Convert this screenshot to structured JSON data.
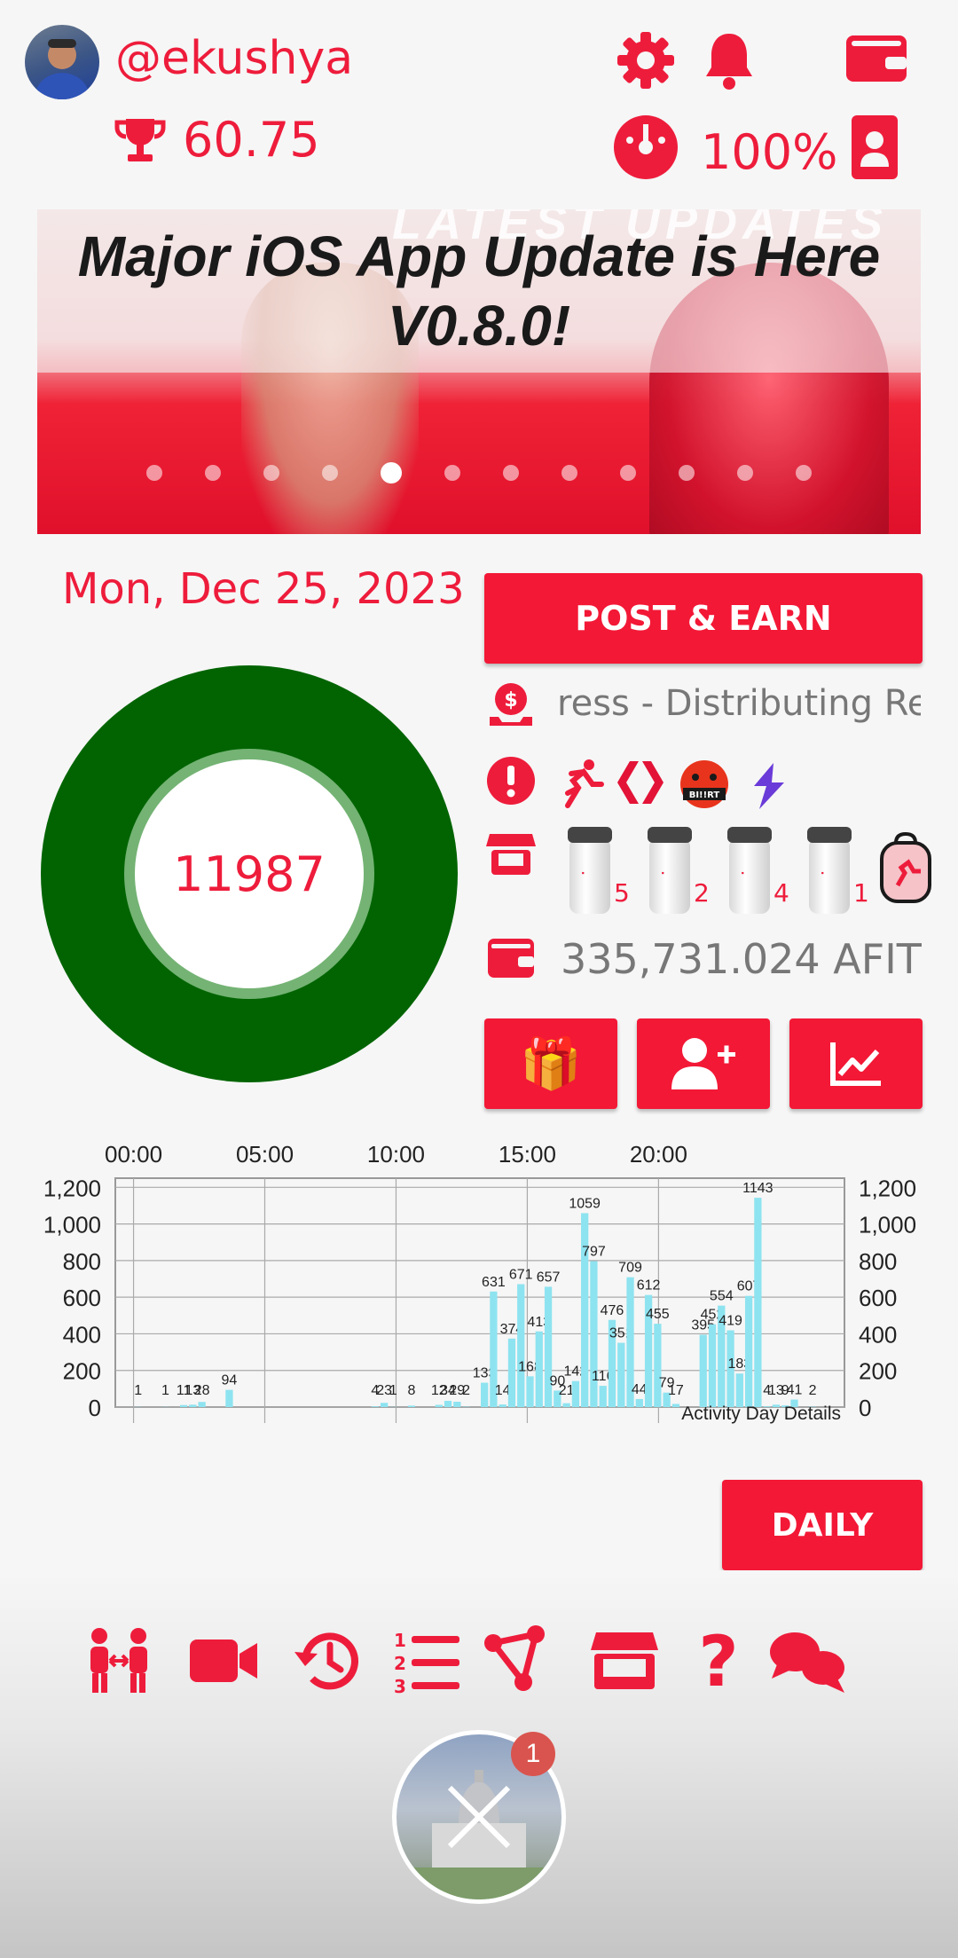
{
  "header": {
    "username": "@ekushya",
    "score": "60.75",
    "battery_pct": "100%"
  },
  "banner": {
    "watermark": "LATEST UPDATES",
    "title_line1": "Major iOS App Update is Here",
    "title_line2": "V0.8.0!",
    "dot_count": 12,
    "active_dot": 4
  },
  "activity": {
    "date": "Mon, Dec 25, 2023",
    "steps": "11987"
  },
  "actions": {
    "post_earn_label": "POST & EARN",
    "ticker_text": "ress - Distributing Rewa",
    "afit_balance": "335,731.024 AFIT",
    "daily_label": "DAILY",
    "gift_emoji": "🎁",
    "bertt_label": "BI!!RT"
  },
  "products": [
    {
      "count": "5"
    },
    {
      "count": "2"
    },
    {
      "count": "4"
    },
    {
      "count": "1"
    }
  ],
  "fab": {
    "badge": "1"
  },
  "colors": {
    "brand_red": "#f31836",
    "ring_green": "#016401",
    "bar_cyan": "#8ee3f0",
    "orange": "#f28a3a"
  },
  "chart_data": {
    "type": "bar",
    "title": "",
    "x_ticks": [
      "00:00",
      "05:00",
      "10:00",
      "15:00",
      "20:00"
    ],
    "y_ticks": [
      "1,200",
      "1,000",
      "800",
      "600",
      "400",
      "200",
      "0"
    ],
    "ylim": [
      0,
      1250
    ],
    "annotation": "Activity Day Details",
    "grid": true,
    "bars": [
      {
        "slot": 2,
        "value": 1
      },
      {
        "slot": 5,
        "value": 1
      },
      {
        "slot": 7,
        "value": 11
      },
      {
        "slot": 8,
        "value": 13
      },
      {
        "slot": 9,
        "value": 28
      },
      {
        "slot": 12,
        "value": 94
      },
      {
        "slot": 28,
        "value": 4
      },
      {
        "slot": 29,
        "value": 23
      },
      {
        "slot": 30,
        "value": 1
      },
      {
        "slot": 32,
        "value": 8
      },
      {
        "slot": 35,
        "value": 12
      },
      {
        "slot": 36,
        "value": 34
      },
      {
        "slot": 37,
        "value": 29
      },
      {
        "slot": 38,
        "value": 2
      },
      {
        "slot": 40,
        "value": 133
      },
      {
        "slot": 41,
        "value": 631
      },
      {
        "slot": 42,
        "value": 14
      },
      {
        "slot": 43,
        "value": 374
      },
      {
        "slot": 44,
        "value": 671
      },
      {
        "slot": 45,
        "value": 168
      },
      {
        "slot": 46,
        "value": 413
      },
      {
        "slot": 47,
        "value": 657
      },
      {
        "slot": 48,
        "value": 90
      },
      {
        "slot": 49,
        "value": 21
      },
      {
        "slot": 50,
        "value": 142
      },
      {
        "slot": 51,
        "value": 1059
      },
      {
        "slot": 52,
        "value": 797
      },
      {
        "slot": 53,
        "value": 116
      },
      {
        "slot": 54,
        "value": 476
      },
      {
        "slot": 55,
        "value": 351
      },
      {
        "slot": 56,
        "value": 709
      },
      {
        "slot": 57,
        "value": 44
      },
      {
        "slot": 58,
        "value": 612
      },
      {
        "slot": 59,
        "value": 455
      },
      {
        "slot": 60,
        "value": 79
      },
      {
        "slot": 61,
        "value": 17
      },
      {
        "slot": 64,
        "value": 395
      },
      {
        "slot": 65,
        "value": 452
      },
      {
        "slot": 66,
        "value": 554
      },
      {
        "slot": 67,
        "value": 419
      },
      {
        "slot": 68,
        "value": 183
      },
      {
        "slot": 69,
        "value": 607
      },
      {
        "slot": 70,
        "value": 1143
      },
      {
        "slot": 71,
        "value": 4
      },
      {
        "slot": 72,
        "value": 13
      },
      {
        "slot": 73,
        "value": 9
      },
      {
        "slot": 74,
        "value": 41
      },
      {
        "slot": 76,
        "value": 2
      }
    ]
  }
}
